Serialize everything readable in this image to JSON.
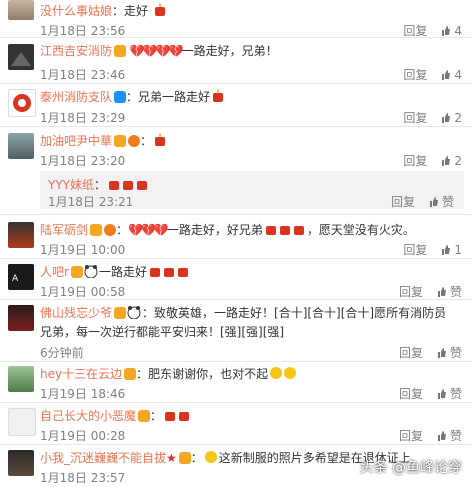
{
  "comments": [
    {
      "user": "没什么事姑娘",
      "text": "：走好",
      "time": "",
      "reply": "",
      "like": ""
    },
    {
      "user": "江西吉安消防",
      "text": "一路走好，兄弟！",
      "time": "1月18日 23:56",
      "reply": "回复",
      "like": "4"
    },
    {
      "user": "泰州消防支队",
      "text": "：兄弟一路走好",
      "time": "1月18日 23:46",
      "reply": "回复",
      "like": "4"
    },
    {
      "user": "加油吧尹中華",
      "text": "：",
      "time": "1月18日 23:29",
      "reply": "回复",
      "like": "2"
    },
    {
      "user": "陆军砺剑",
      "text": "：",
      "time": "1月18日 23:20",
      "reply": "回复",
      "like": "2"
    },
    {
      "user": "人吧r",
      "text": "一路走好",
      "time": "1月19日 10:00",
      "reply": "回复",
      "like": "1"
    },
    {
      "user": "佛山残忘少爷",
      "text": "：致敬英雄，一路走好！[合十][合十][合十]愿所有消防员",
      "text2": "兄弟，每一次逆行都能平安归来！[强][强][强]",
      "time": "1月19日 00:58",
      "reply": "回复",
      "like": "赞"
    },
    {
      "user": "hey十三在云边",
      "text": "：肥东谢谢你，也对不起",
      "time": "6分钟前",
      "reply": "回复",
      "like": "赞"
    },
    {
      "user": "自己长大的小恶魔",
      "text": "：",
      "time": "1月19日 18:46",
      "reply": "回复",
      "like": "赞"
    },
    {
      "user": "小我_沉迷巍巍不能自拔",
      "text": "这新制服的照片多希望是在退休证上",
      "time": "1月19日 00:28",
      "reply": "回复",
      "like": "赞"
    }
  ],
  "quote": {
    "user": "YYY妹纸",
    "text": "：",
    "time": "1月18日 23:21",
    "reply": "回复",
    "like": "赞"
  },
  "lucun_tail": "，愿天堂没有火灾。",
  "lucun_mid": "一路走好，好兄弟",
  "last_time": "1月18日 23:57",
  "watermark": "头条 @鱼峰论穿",
  "colors": {
    "nick": "#eb7350",
    "fire": "#d9341f"
  }
}
